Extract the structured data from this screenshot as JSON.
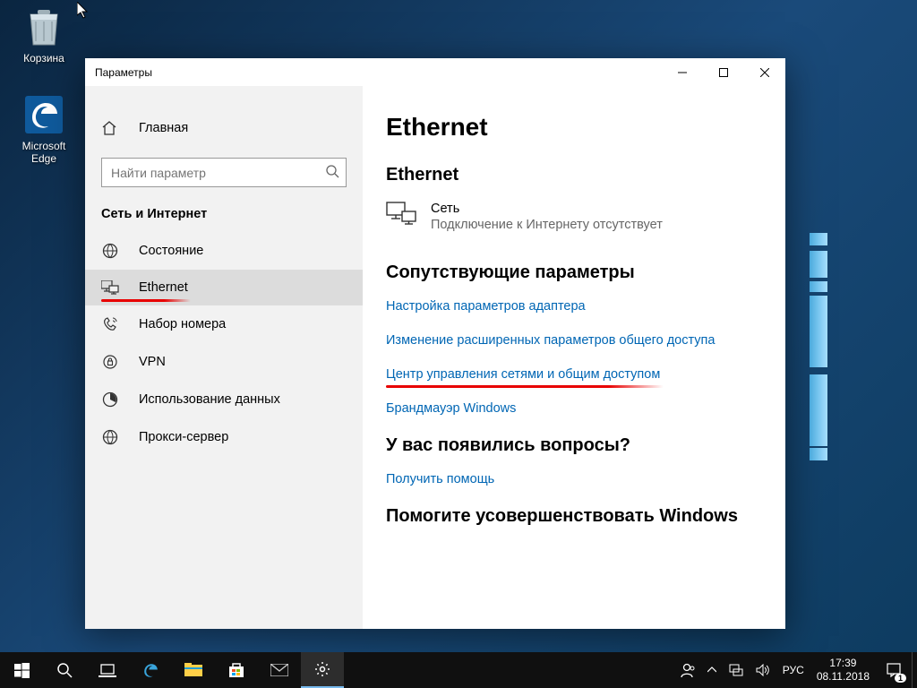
{
  "desktop": {
    "recycle_bin": "Корзина",
    "edge": "Microsoft Edge"
  },
  "window": {
    "title": "Параметры",
    "home": "Главная",
    "search_placeholder": "Найти параметр",
    "section": "Сеть и Интернет",
    "nav": [
      {
        "icon": "status",
        "label": "Состояние"
      },
      {
        "icon": "ethernet",
        "label": "Ethernet",
        "active": true,
        "underline": true
      },
      {
        "icon": "dialup",
        "label": "Набор номера"
      },
      {
        "icon": "vpn",
        "label": "VPN"
      },
      {
        "icon": "data",
        "label": "Использование данных"
      },
      {
        "icon": "proxy",
        "label": "Прокси-сервер"
      }
    ]
  },
  "content": {
    "h1": "Ethernet",
    "h2": "Ethernet",
    "net_name": "Сеть",
    "net_status": "Подключение к Интернету отсутствует",
    "related_title": "Сопутствующие параметры",
    "links": [
      {
        "t": "Настройка параметров адаптера"
      },
      {
        "t": "Изменение расширенных параметров общего доступа"
      },
      {
        "t": "Центр управления сетями и общим доступом",
        "underline": true
      },
      {
        "t": "Брандмауэр Windows"
      }
    ],
    "q_title": "У вас появились вопросы?",
    "q_link": "Получить помощь",
    "improve_title": "Помогите усовершенствовать Windows"
  },
  "taskbar": {
    "lang": "РУС",
    "time": "17:39",
    "date": "08.11.2018",
    "notif_count": "1"
  }
}
